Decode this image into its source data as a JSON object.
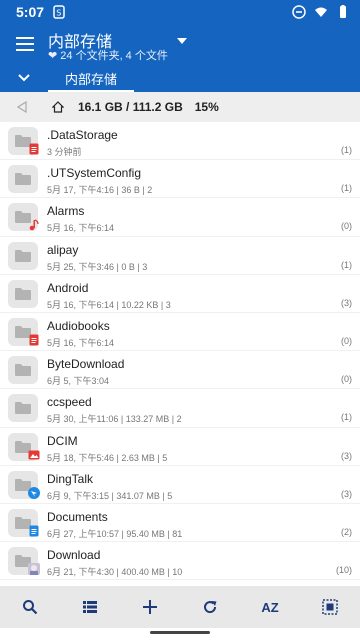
{
  "statusbar": {
    "time": "5:07"
  },
  "appbar": {
    "title": "内部存储",
    "subtitle": "❤ 24 个文件夹, 4 个文件"
  },
  "tabs": [
    {
      "label": "内部存储"
    }
  ],
  "path": {
    "storage": "16.1 GB / 111.2 GB",
    "percent": "15%"
  },
  "items": [
    {
      "name": ".DataStorage",
      "meta": "3 分钟前",
      "count": "(1)",
      "badge": "doc-red"
    },
    {
      "name": ".UTSystemConfig",
      "meta": "5月 17, 下午4:16 | 36 B | 2",
      "count": "(1)",
      "badge": ""
    },
    {
      "name": "Alarms",
      "meta": "5月 16, 下午6:14",
      "count": "(0)",
      "badge": "music"
    },
    {
      "name": "alipay",
      "meta": "5月 25, 下午3:46 | 0 B | 3",
      "count": "(1)",
      "badge": ""
    },
    {
      "name": "Android",
      "meta": "5月 16, 下午6:14 | 10.22  KB | 3",
      "count": "(3)",
      "badge": ""
    },
    {
      "name": "Audiobooks",
      "meta": "5月 16, 下午6:14",
      "count": "(0)",
      "badge": "doc-red"
    },
    {
      "name": "ByteDownload",
      "meta": "6月 5, 下午3:04",
      "count": "(0)",
      "badge": ""
    },
    {
      "name": "ccspeed",
      "meta": "5月 30, 上午11:06 | 133.27 MB | 2",
      "count": "(1)",
      "badge": ""
    },
    {
      "name": "DCIM",
      "meta": "5月 18, 下午5:46 | 2.63 MB | 5",
      "count": "(3)",
      "badge": "image-red"
    },
    {
      "name": "DingTalk",
      "meta": "6月 9, 下午3:15 | 341.07 MB | 5",
      "count": "(3)",
      "badge": "dingtalk"
    },
    {
      "name": "Documents",
      "meta": "6月 27, 上午10:57 | 95.40 MB | 81",
      "count": "(2)",
      "badge": "doc-blue"
    },
    {
      "name": "Download",
      "meta": "6月 21, 下午4:30 | 400.40 MB | 10",
      "count": "(10)",
      "badge": "thumb"
    }
  ],
  "toolbar": [
    {
      "icon": "search-icon"
    },
    {
      "icon": "list-view-icon"
    },
    {
      "icon": "add-icon"
    },
    {
      "icon": "refresh-icon"
    },
    {
      "icon": "sort-az-icon",
      "label": "AZ"
    },
    {
      "icon": "select-all-icon"
    }
  ],
  "colors": {
    "primary": "#1565c0",
    "folder_bg": "#e6e6e6",
    "toolbar_bg": "#e8e8e8"
  }
}
